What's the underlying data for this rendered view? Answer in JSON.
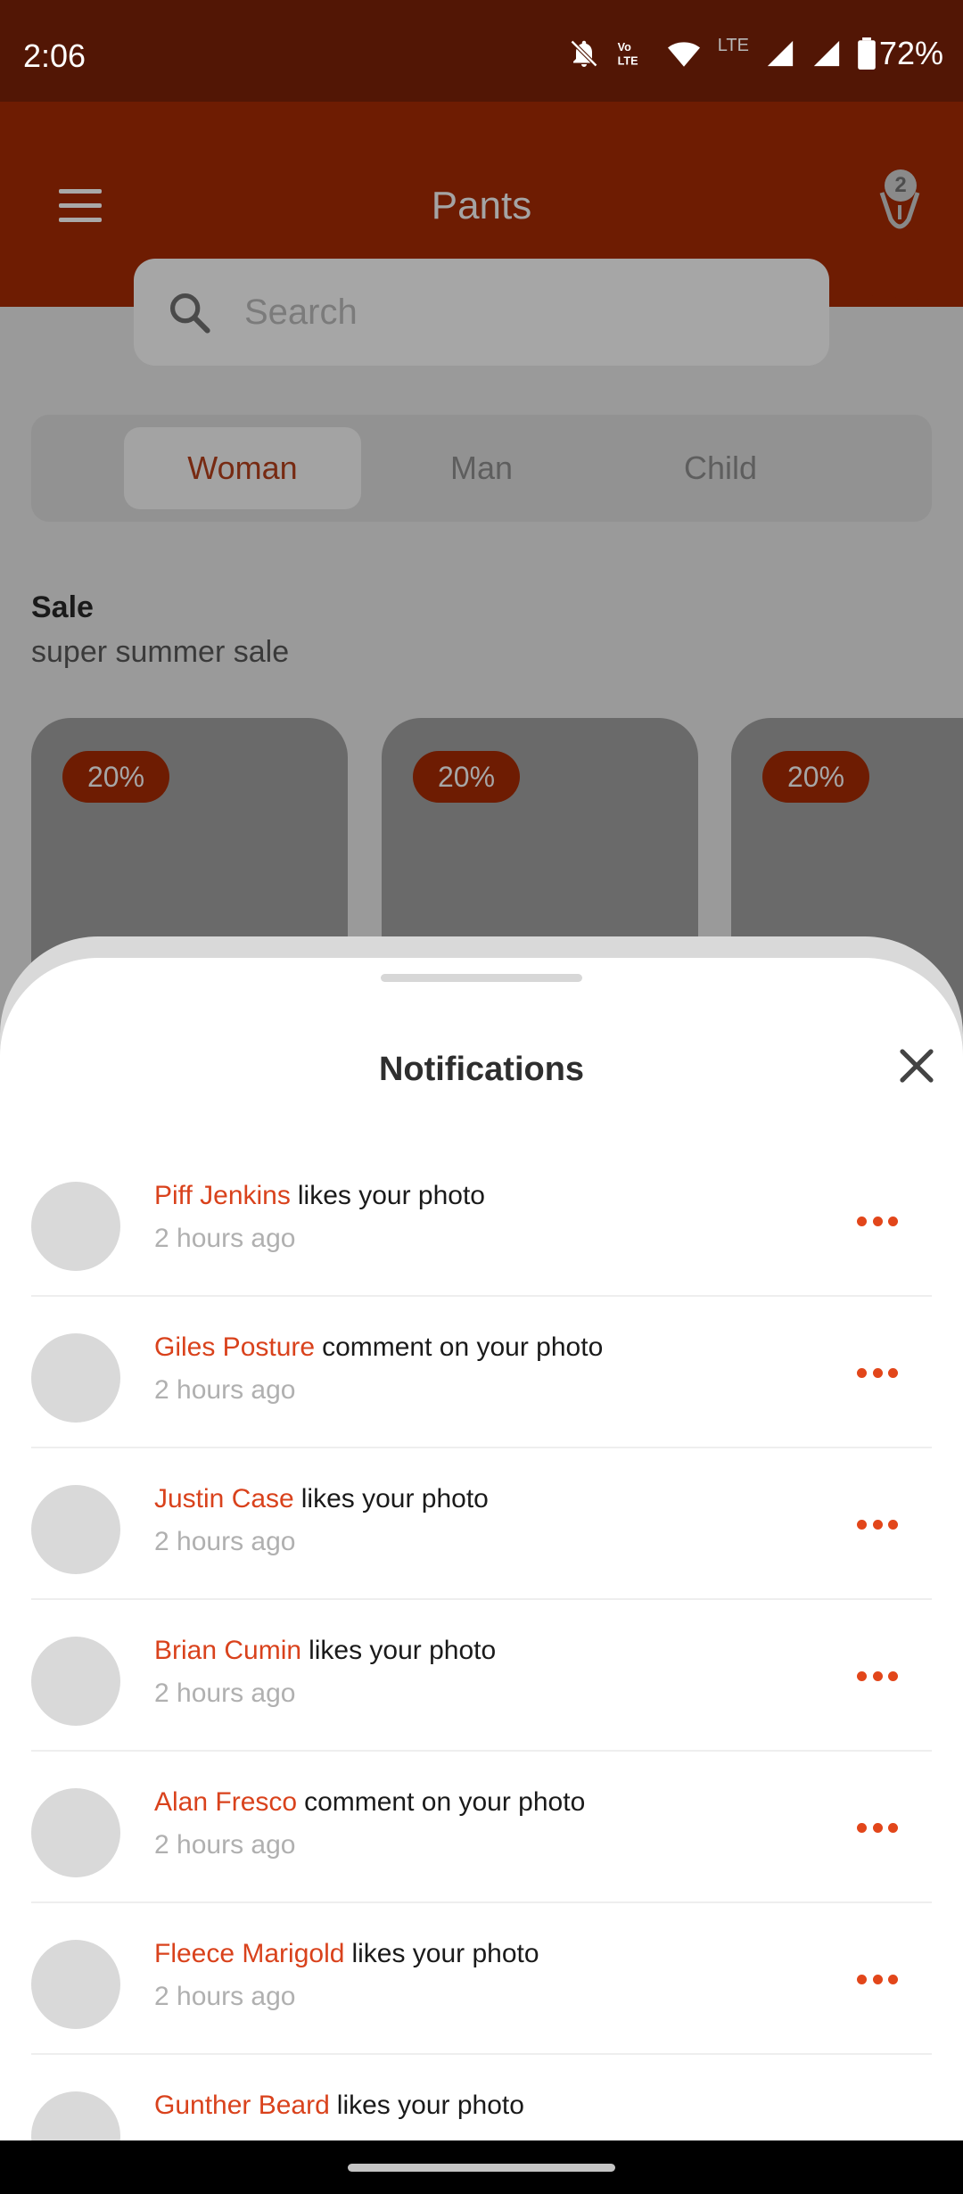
{
  "status_bar": {
    "time": "2:06",
    "battery": "72%",
    "network": "LTE"
  },
  "header": {
    "title": "Pants",
    "cart_count": "2"
  },
  "search": {
    "placeholder": "Search"
  },
  "segments": {
    "woman": "Woman",
    "man": "Man",
    "child": "Child"
  },
  "sale": {
    "title": "Sale",
    "subtitle": "super summer sale"
  },
  "products": [
    {
      "discount": "20%"
    },
    {
      "discount": "20%"
    },
    {
      "discount": "20%"
    }
  ],
  "sheet": {
    "title": "Notifications"
  },
  "notifications": [
    {
      "name": "Piff Jenkins",
      "action": "likes your photo",
      "time": "2 hours ago"
    },
    {
      "name": "Giles Posture",
      "action": "comment on your photo",
      "time": "2 hours ago"
    },
    {
      "name": "Justin Case",
      "action": "likes your photo",
      "time": "2 hours ago"
    },
    {
      "name": "Brian Cumin",
      "action": "likes your photo",
      "time": "2 hours ago"
    },
    {
      "name": "Alan Fresco",
      "action": "comment on your photo",
      "time": "2 hours ago"
    },
    {
      "name": "Fleece Marigold",
      "action": "likes your photo",
      "time": "2 hours ago"
    },
    {
      "name": "Gunther Beard",
      "action": "likes your photo",
      "time": ""
    }
  ],
  "colors": {
    "accent": "#e2461a",
    "header": "#6e1c02",
    "status_bar": "#521605"
  }
}
